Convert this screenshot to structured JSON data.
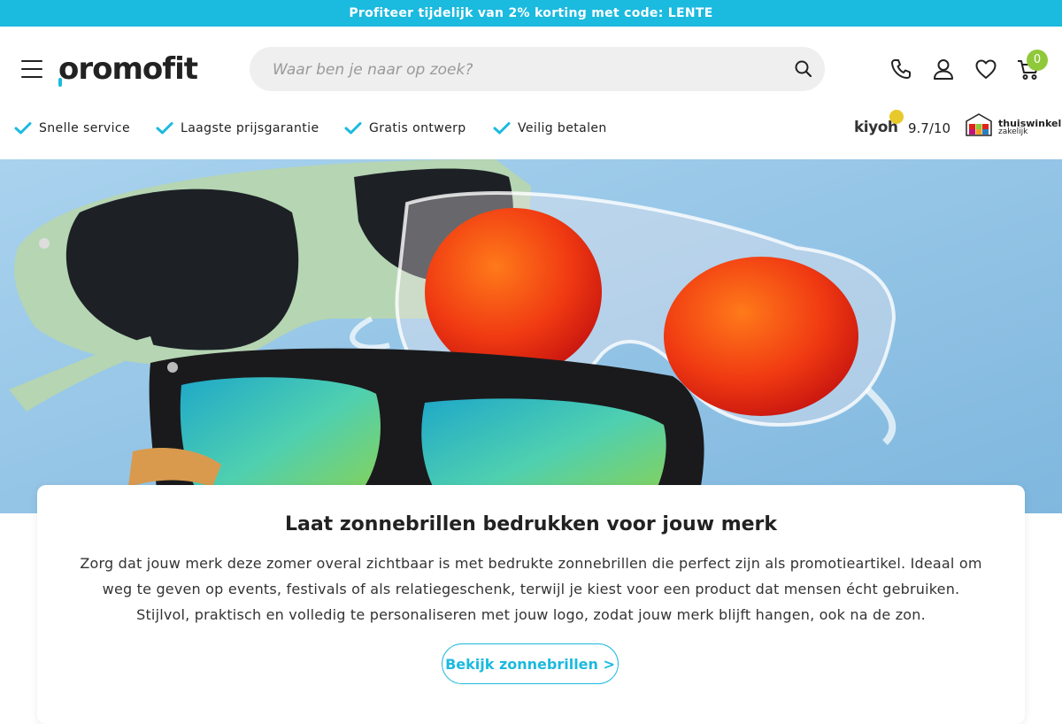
{
  "promo_bar": {
    "text": "Profiteer tijdelijk van 2% korting met code: LENTE"
  },
  "header": {
    "logo_text": "oromofit",
    "search": {
      "placeholder": "Waar ben je naar op zoek?",
      "value": ""
    },
    "cart_count": "0",
    "icons": [
      "menu-icon",
      "search-icon",
      "phone-icon",
      "account-icon",
      "heart-icon",
      "cart-icon"
    ]
  },
  "usps": [
    {
      "label": "Snelle service"
    },
    {
      "label": "Laagste prijsgarantie"
    },
    {
      "label": "Gratis ontwerp"
    },
    {
      "label": "Veilig betalen"
    }
  ],
  "trust": {
    "kiyoh_label": "kiyoh",
    "rating": "9.7/10",
    "thuiswinkel_line1": "thuiswinkel",
    "thuiswinkel_line2": "zakelijk"
  },
  "content": {
    "title": "Laat zonnebrillen bedrukken voor jouw merk",
    "body": "Zorg dat jouw merk deze zomer overal zichtbaar is met bedrukte zonnebrillen die perfect zijn als promotieartikel. Ideaal om weg te geven op events, festivals of als relatiegeschenk, terwijl je kiest voor een product dat mensen écht gebruiken. Stijlvol, praktisch en volledig te personaliseren met jouw logo, zodat jouw merk blijft hangen, ook na de zon.",
    "cta_label": "Bekijk zonnebrillen >"
  },
  "colors": {
    "accent": "#1bbadf",
    "badge": "#8fc93a",
    "hero_bg": "#8fc4e6"
  }
}
